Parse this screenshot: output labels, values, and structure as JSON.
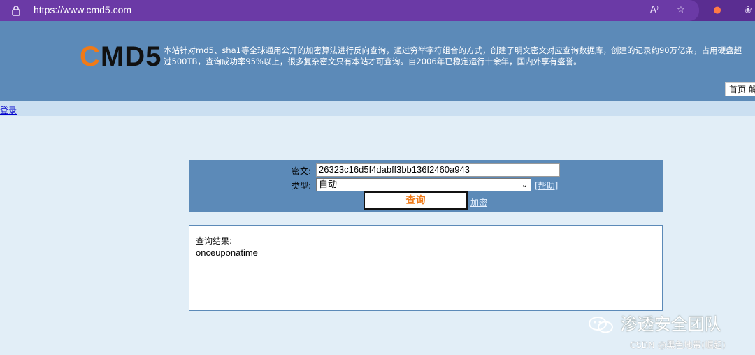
{
  "browser": {
    "url": "https://www.cmd5.com",
    "icons": [
      "lock-icon",
      "read-aloud-icon",
      "favorite-add-icon",
      "extension-icon",
      "account-icon"
    ]
  },
  "header": {
    "logo_c": "C",
    "logo_rest": "MD5",
    "intro_line1": "本站针对md5、sha1等全球通用公开的加密算法进行反向查询，通过穷举字符组合的方式，创建了明文密文对应查询数据库，创建的记录约90万亿条，占用硬盘超",
    "intro_line2": "过500TB，查询成功率95%以上，很多复杂密文只有本站才可查询。自2006年已稳定运行十余年，国内外享有盛誉。",
    "nav_home": "首页",
    "nav_next": "解"
  },
  "subbar": {
    "login": "登录"
  },
  "form": {
    "cipher_label": "密文:",
    "cipher_value": "26323c16d5f4dabff3bb136f2460a943",
    "type_label": "类型:",
    "type_value": "自动",
    "help": "[帮助]",
    "query_button": "查询",
    "encrypt_link": "加密"
  },
  "result": {
    "label": "查询结果:",
    "value": "onceuponatime"
  },
  "watermark": {
    "main": "渗透安全团队",
    "sub": "CSDN @黑色地带(崛起)"
  },
  "colors": {
    "browser": "#5a2d91",
    "header": "#5c8ab8",
    "accent": "#f07a17",
    "page": "#e2eef7"
  }
}
